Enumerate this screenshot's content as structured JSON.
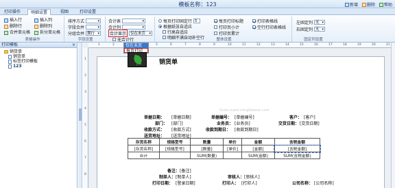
{
  "window": {
    "title": "模板名称：123",
    "actions": [
      "新增",
      "删除",
      "帮助"
    ]
  },
  "tabs": [
    "打印操作",
    "明细设置",
    "视图",
    "打印设置"
  ],
  "active_tab": "明细设置",
  "ribbon": {
    "table_ops": {
      "label": "表格操作",
      "buttons": [
        "插入行",
        "插入列",
        "删除行",
        "删除列",
        "合并单元格",
        "拆分单元格"
      ]
    },
    "field_settings": {
      "label": "字段设置",
      "sort_label": "排序方式",
      "sort_value": "",
      "font_label": "字段合并",
      "font_value": "",
      "group_label": "分组合并",
      "group_value": "换行"
    },
    "subtotal": {
      "row1_label": "合计表",
      "row1_value": "",
      "row2_label": "合计列",
      "row2_value": "",
      "row3_label": "合计显示",
      "row3_value": "仅在末页",
      "row4_label": "无合计行"
    },
    "page_settings": {
      "label": "整体设置",
      "opt1": "每页打印固定行",
      "opt1_value": "5",
      "opt2": "根据纸张自适应",
      "opt3": "行高自适应",
      "opt4": "明细不满自动补空行",
      "opt5": "每页打印标题",
      "opt6": "打印页小计",
      "opt7": "打印页累计",
      "opt8": "打印表格线",
      "opt9": "空行打印表格线"
    },
    "fixed_settings": {
      "label": "固定列设置",
      "left_label": "左固定列",
      "left_value": "无",
      "right_label": "右固定列",
      "right_value": "无"
    }
  },
  "dropdown": {
    "items": [
      "仅在末页",
      "每页打印"
    ],
    "selected": "仅在末页"
  },
  "panel": {
    "title": "打印模板",
    "tree": [
      {
        "label": "销货单",
        "level": 0
      },
      {
        "label": "销货单",
        "level": 1
      },
      {
        "label": "标签打印模板",
        "level": 1
      },
      {
        "label": "123",
        "level": 1
      }
    ]
  },
  "ruler": {
    "h_ticks": [
      "1",
      "2",
      "3",
      "4",
      "5",
      "6",
      "7",
      "8",
      "9",
      "10",
      "11",
      "12",
      "13",
      "14",
      "15",
      "16",
      "17",
      "18",
      "19",
      "20",
      "21"
    ],
    "v_ticks": [
      "1",
      "2",
      "3",
      "4",
      "5",
      "6",
      "7",
      "8"
    ]
  },
  "report": {
    "title": "销货单",
    "watermark": "Scala.xuexi.minglikexue.com",
    "fields": [
      {
        "label": "单据日期：",
        "value": "[单据日期]"
      },
      {
        "label": "单据编号：",
        "value": "[单据编号]"
      },
      {
        "label": "客户：",
        "value": "[客户]"
      },
      {
        "label": "部门：",
        "value": "[部门]"
      },
      {
        "label": "业务员：",
        "value": "[业务员]"
      },
      {
        "label": "交货日期：",
        "value": "[交货日期]"
      },
      {
        "label": "收款方式：",
        "value": "[收款方式]"
      },
      {
        "label": "收款到期日：",
        "value": "[收款到期日]"
      },
      {
        "label": "送货地址：",
        "value": "[送货地址]"
      }
    ],
    "table_headers": [
      "存货名称",
      "规格型号",
      "数量",
      "单价",
      "金额",
      "含税金额"
    ],
    "table_row": [
      "[存货名称]",
      "[规格型号]",
      "[数量]",
      "[单价]",
      "[金额]",
      "[含税金额]"
    ],
    "total_row": [
      "合计",
      "",
      "SUM(数量)",
      "",
      "SUM(金额)",
      "SUM(含税金额)"
    ],
    "footer": [
      {
        "label": "备注：",
        "value": "[备注]"
      },
      {
        "label": "制单人：",
        "value": "[制单人]"
      },
      {
        "label": "审核人：",
        "value": "[审核人]"
      },
      {
        "label": "打印日期：",
        "value": "[登录日期]"
      },
      {
        "label": "打印人：",
        "value": "[打印人]"
      },
      {
        "label": "公司名称：",
        "value": "[公司名称]"
      }
    ]
  }
}
